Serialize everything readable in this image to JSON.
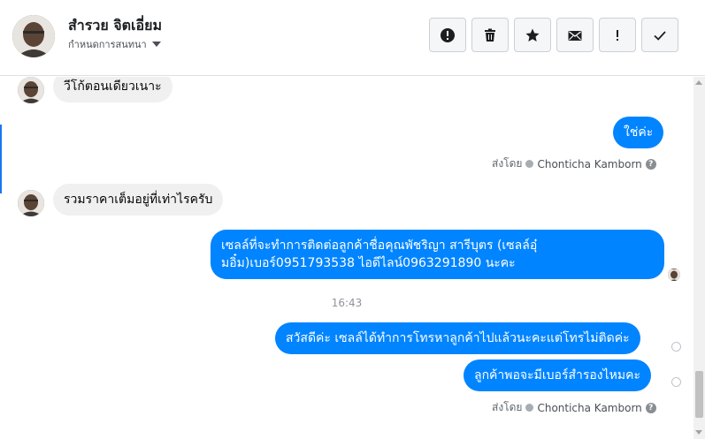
{
  "header": {
    "contact_name": "สำรวย จิตเอี่ยม",
    "conversation_settings": "กำหนดการสนทนา",
    "toolbar": [
      {
        "name": "mark-spam-button",
        "icon": "alert-circle-icon"
      },
      {
        "name": "delete-button",
        "icon": "trash-icon"
      },
      {
        "name": "star-button",
        "icon": "star-icon"
      },
      {
        "name": "mark-unread-button",
        "icon": "envelope-icon"
      },
      {
        "name": "follow-up-button",
        "icon": "exclamation-icon"
      },
      {
        "name": "mark-done-button",
        "icon": "check-icon"
      }
    ]
  },
  "thread": {
    "messages": {
      "m1": "วีโก้ตอนเดียวเนาะ",
      "m2": "ใช่ค่ะ",
      "m3": "รวมราคาเต็มอยู่ที่เท่าไรครับ",
      "m4": "เซลล์ที่จะทำการติดต่อลูกค้าชื่อคุณพัชริญา สารีบุตร (เซลล์อุ๋มอิ๋ม)เบอร์0951793538 ไอดีไลน์0963291890 นะคะ",
      "m5": "สวัสดีค่ะ เซลล์ได้ทำการโทรหาลูกค้าไปแล้วนะคะแต่โทรไม่ติดค่ะ",
      "m6": "ลูกค้าพอจะมีเบอร์สำรองไหมคะ"
    },
    "sent_by_label": "ส่งโดย",
    "agent_name": "Chonticha Kamborn",
    "help_glyph": "?",
    "timestamp": "16:43"
  },
  "colors": {
    "outgoing_bubble": "#0084ff",
    "incoming_bubble": "#f0f0f0",
    "accent": "#1877f2"
  }
}
